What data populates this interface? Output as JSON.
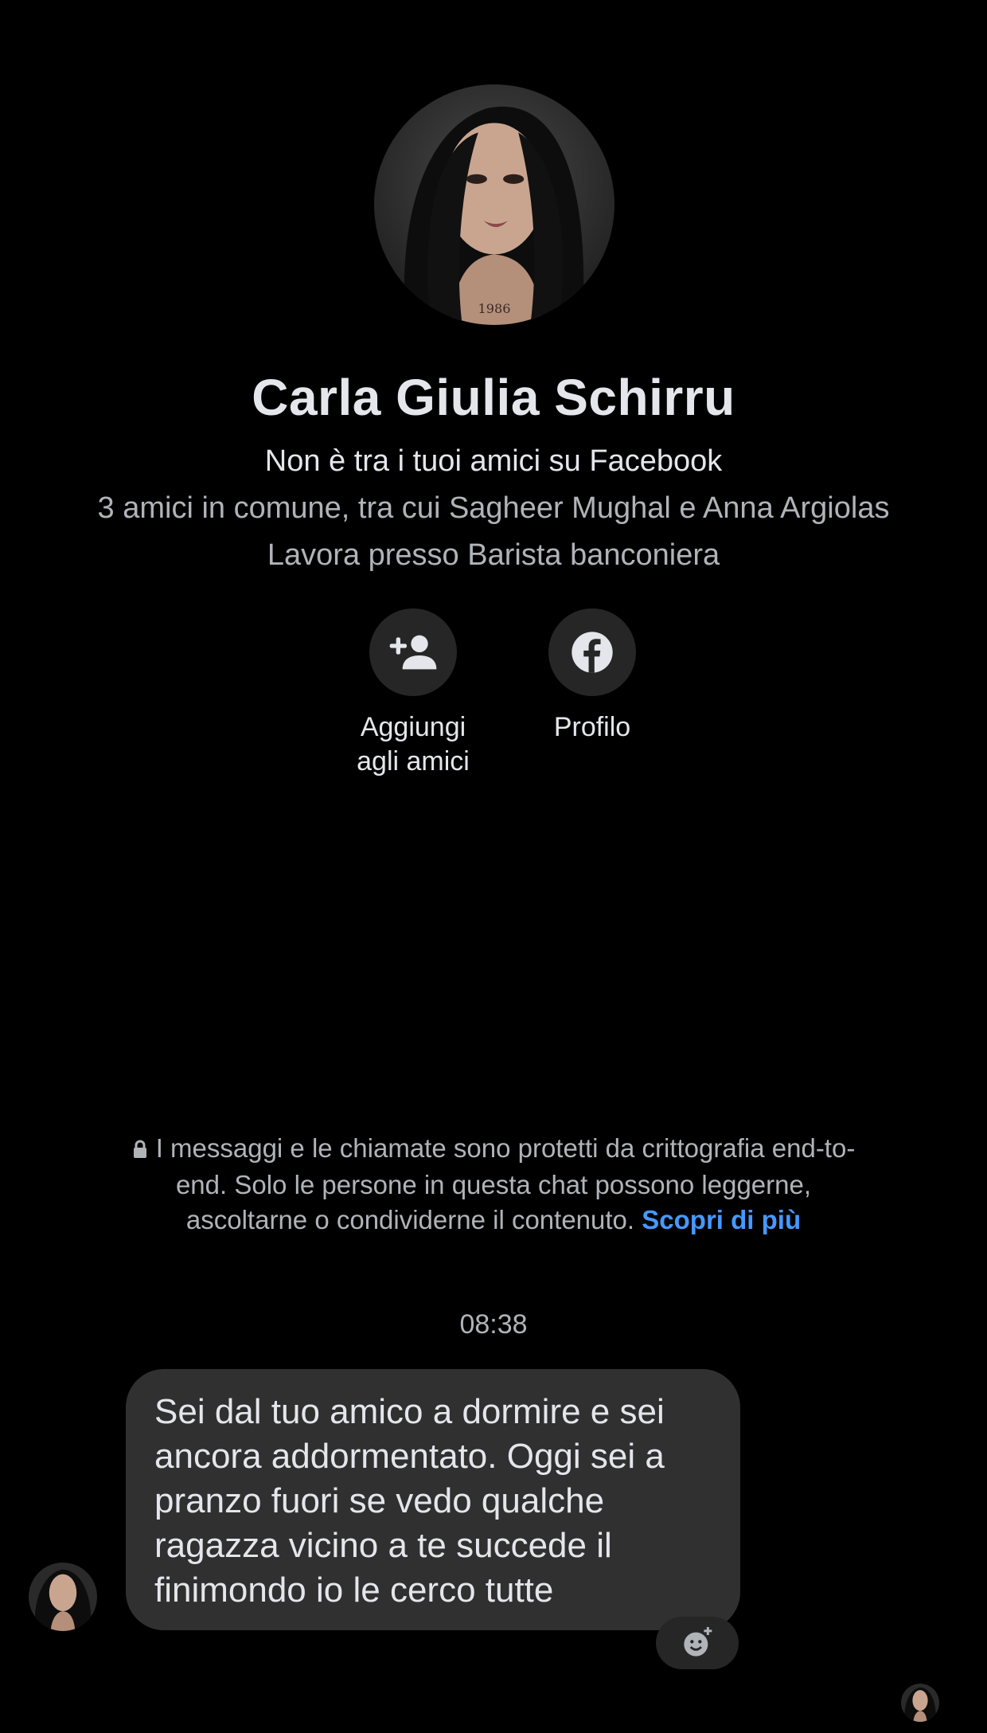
{
  "contact": {
    "name": "Carla Giulia Schirru",
    "status": "Non è tra i tuoi amici su Facebook",
    "mutual_friends": "3 amici in comune, tra cui Sagheer Mughal e Anna Argiolas",
    "work": "Lavora presso Barista banconiera",
    "avatar_icon": "profile-photo"
  },
  "actions": {
    "add_friend_line1": "Aggiungi",
    "add_friend_line2": "agli amici",
    "add_friend_icon": "person-add-icon",
    "profile": "Profilo",
    "profile_icon": "facebook-icon"
  },
  "encryption": {
    "text": "I messaggi e le chiamate sono protetti da crittografia end-to-end. Solo le persone in questa chat possono leggerne, ascoltarne o condividerne il contenuto.",
    "learn_more": "Scopri di più",
    "icon": "lock-icon"
  },
  "conversation": {
    "timestamp": "08:38",
    "messages": [
      {
        "text": "Sei dal tuo amico a dormire e sei ancora addormentato. Oggi sei a pranzo fuori se vedo qualche ragazza vicino a te succede il finimondo io le cerco tutte"
      }
    ],
    "reaction_icon": "add-reaction-icon"
  },
  "colors": {
    "background": "#000000",
    "bubble": "#303030",
    "link": "#4599ff",
    "secondary_text": "#b0b3b8"
  }
}
